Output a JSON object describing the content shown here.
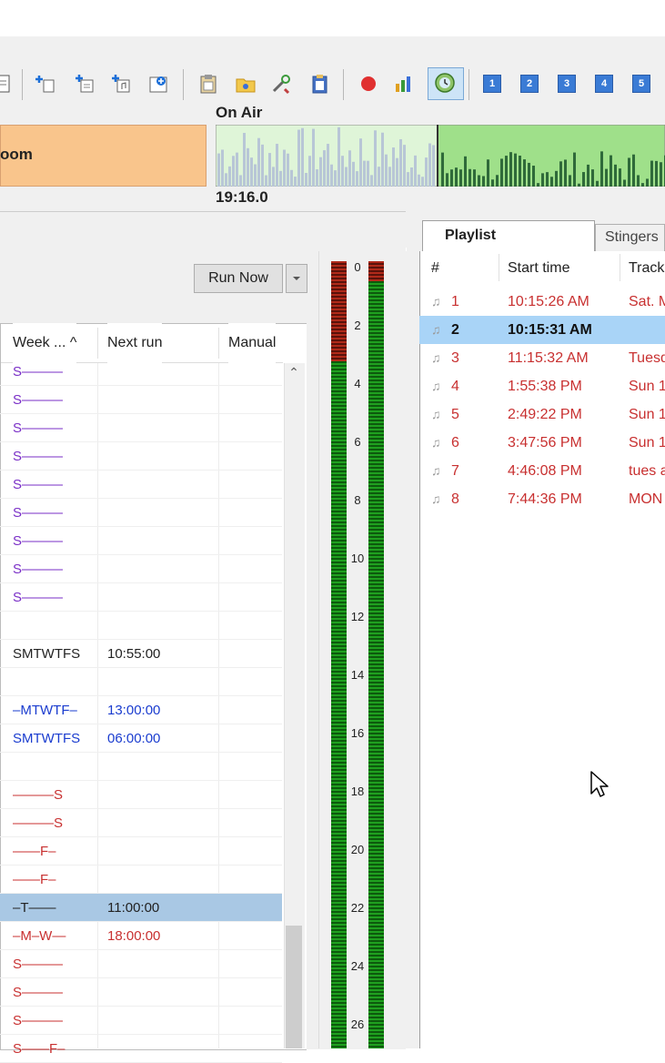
{
  "toolbar": {
    "icons": [
      "document-icon",
      "add-track-icon",
      "insert-icon",
      "add-music-icon",
      "add-file-icon",
      "clipboard-icon",
      "folder-music-icon",
      "tools-icon",
      "paste-icon",
      "record-icon",
      "meter-icon",
      "clock-icon"
    ],
    "numbered_buttons": [
      "1",
      "2",
      "3",
      "4",
      "5"
    ]
  },
  "onair": {
    "label": "On Air",
    "time": "19:16.0",
    "room_label": "oom"
  },
  "events": {
    "run_now_label": "Run Now",
    "columns": [
      "Week ... ^",
      "Next run",
      "Manual"
    ],
    "rows": [
      {
        "week": "S———",
        "next": "",
        "color": "#7a2fc7"
      },
      {
        "week": "S———",
        "next": "",
        "color": "#7a2fc7"
      },
      {
        "week": "S———",
        "next": "",
        "color": "#7a2fc7"
      },
      {
        "week": "S———",
        "next": "",
        "color": "#7a2fc7"
      },
      {
        "week": "S———",
        "next": "",
        "color": "#7a2fc7"
      },
      {
        "week": "S———",
        "next": "",
        "color": "#7a2fc7"
      },
      {
        "week": "S———",
        "next": "",
        "color": "#7a2fc7"
      },
      {
        "week": "S———",
        "next": "",
        "color": "#7a2fc7"
      },
      {
        "week": "S———",
        "next": "",
        "color": "#7a2fc7"
      },
      {
        "week": "",
        "next": "",
        "color": "#222222"
      },
      {
        "week": "SMTWTFS",
        "next": "10:55:00",
        "color": "#222222"
      },
      {
        "week": "",
        "next": "",
        "color": "#222222"
      },
      {
        "week": "–MTWTF–",
        "next": "13:00:00",
        "color": "#1a3ccf"
      },
      {
        "week": "SMTWTFS",
        "next": "06:00:00",
        "color": "#1a3ccf"
      },
      {
        "week": "",
        "next": "",
        "color": "#222222"
      },
      {
        "week": "———S",
        "next": "",
        "color": "#c83030"
      },
      {
        "week": "———S",
        "next": "",
        "color": "#c83030"
      },
      {
        "week": "——F–",
        "next": "",
        "color": "#c83030"
      },
      {
        "week": "——F–",
        "next": "",
        "color": "#c83030"
      },
      {
        "week": "–T——",
        "next": "11:00:00",
        "color": "#222222",
        "selected": true
      },
      {
        "week": "–M–W—",
        "next": "18:00:00",
        "color": "#c83030"
      },
      {
        "week": "S———",
        "next": "",
        "color": "#c83030"
      },
      {
        "week": "S———",
        "next": "",
        "color": "#c83030"
      },
      {
        "week": "S———",
        "next": "",
        "color": "#c83030"
      },
      {
        "week": "S——F–",
        "next": "",
        "color": "#c83030"
      }
    ]
  },
  "vu_meter": {
    "scale": [
      "0",
      "2",
      "4",
      "6",
      "8",
      "10",
      "12",
      "14",
      "16",
      "18",
      "20",
      "22",
      "24",
      "26"
    ]
  },
  "playlist": {
    "tabs": [
      "Playlist",
      "Stingers"
    ],
    "columns": [
      "#",
      "Start time",
      "Track"
    ],
    "rows": [
      {
        "num": "1",
        "start": "10:15:26 AM",
        "track": "Sat. M",
        "color": "#c83030"
      },
      {
        "num": "2",
        "start": "10:15:31 AM",
        "track": "",
        "color": "#111111",
        "current": true
      },
      {
        "num": "3",
        "start": "11:15:32 AM",
        "track": "Tuesd",
        "color": "#c83030"
      },
      {
        "num": "4",
        "start": "1:55:38 PM",
        "track": "Sun 1",
        "color": "#c83030"
      },
      {
        "num": "5",
        "start": "2:49:22 PM",
        "track": "Sun 1",
        "color": "#c83030"
      },
      {
        "num": "6",
        "start": "3:47:56 PM",
        "track": "Sun 1",
        "color": "#c83030"
      },
      {
        "num": "7",
        "start": "4:46:08 PM",
        "track": "tues a",
        "color": "#c83030"
      },
      {
        "num": "8",
        "start": "7:44:36 PM",
        "track": "MON",
        "color": "#c83030"
      }
    ]
  }
}
